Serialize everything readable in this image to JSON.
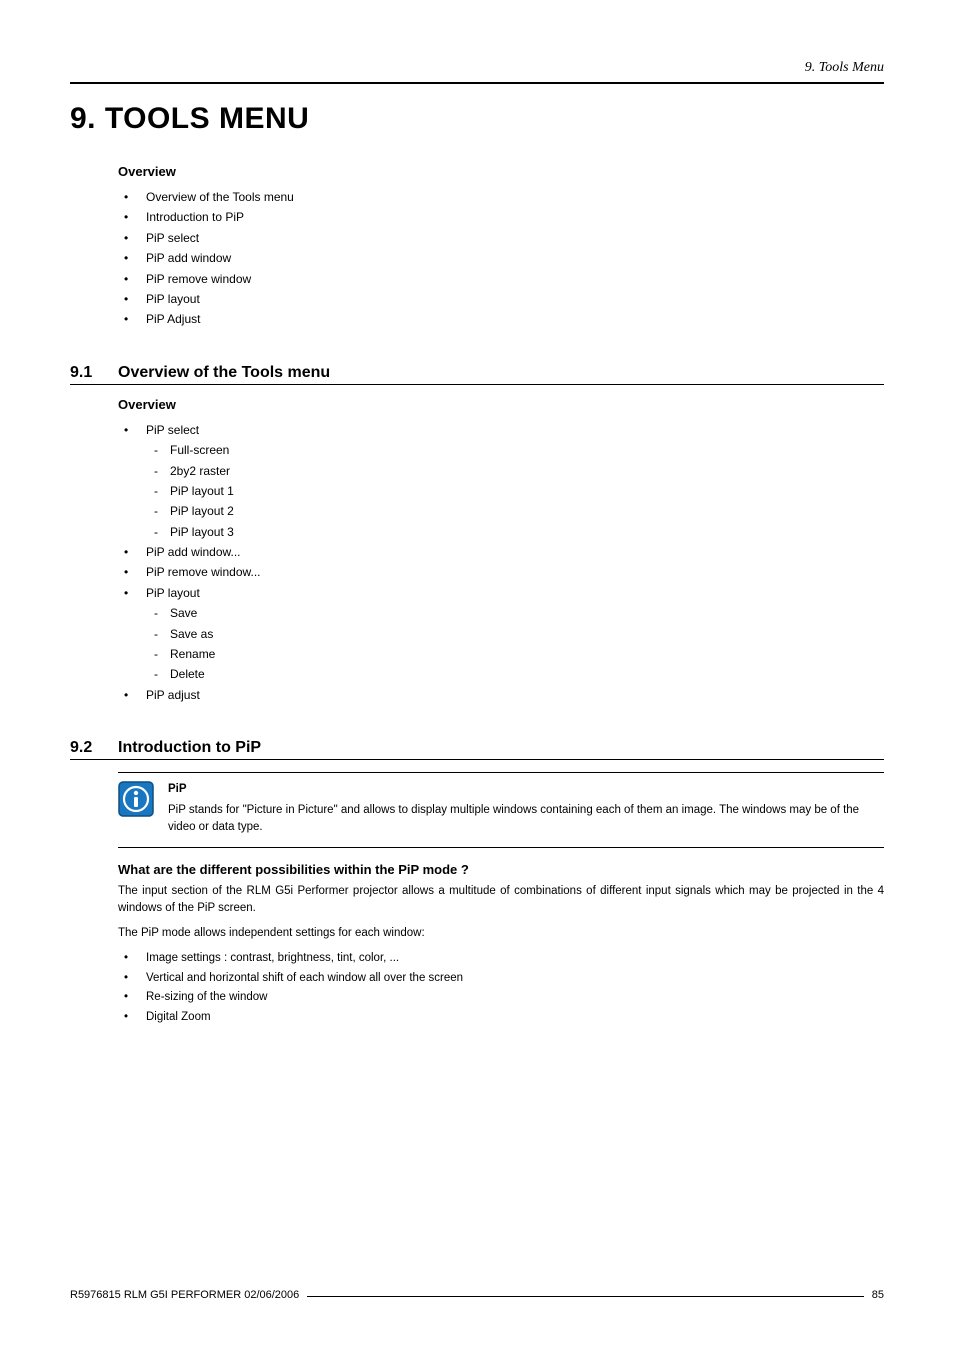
{
  "header": {
    "running": "9.  Tools Menu"
  },
  "chapter": {
    "title": "9. TOOLS MENU"
  },
  "overview": {
    "heading": "Overview",
    "items": [
      "Overview of the Tools menu",
      "Introduction to PiP",
      "PiP select",
      "PiP add window",
      "PiP remove window",
      "PiP layout",
      "PiP Adjust"
    ]
  },
  "section91": {
    "num": "9.1",
    "title": "Overview of the Tools menu",
    "heading": "Overview",
    "items": [
      {
        "text": "PiP select",
        "sub": [
          "Full-screen",
          "2by2 raster",
          "PiP layout 1",
          "PiP layout 2",
          "PiP layout 3"
        ]
      },
      {
        "text": "PiP add window..."
      },
      {
        "text": "PiP remove window..."
      },
      {
        "text": "PiP layout",
        "sub": [
          "Save",
          "Save as",
          "Rename",
          "Delete"
        ]
      },
      {
        "text": "PiP adjust"
      }
    ]
  },
  "section92": {
    "num": "9.2",
    "title": "Introduction to PiP",
    "info": {
      "term": "PiP",
      "body": "PiP stands for \"Picture in Picture\" and allows to display multiple windows containing each of them an image.  The windows may be of the video or data type."
    },
    "q_heading": "What are the different possibilities within the PiP mode ?",
    "para1": "The input section of the RLM G5i Performer projector allows a multitude of combinations of different input signals which may be projected in the 4 windows of the PiP screen.",
    "para2": "The PiP mode allows independent settings for each window:",
    "settings": [
      "Image settings :  contrast, brightness, tint, color, ...",
      "Vertical and horizontal shift of each window all over the screen",
      "Re-sizing of the window",
      "Digital Zoom"
    ]
  },
  "footer": {
    "left": "R5976815  RLM G5I PERFORMER  02/06/2006",
    "right": "85"
  }
}
